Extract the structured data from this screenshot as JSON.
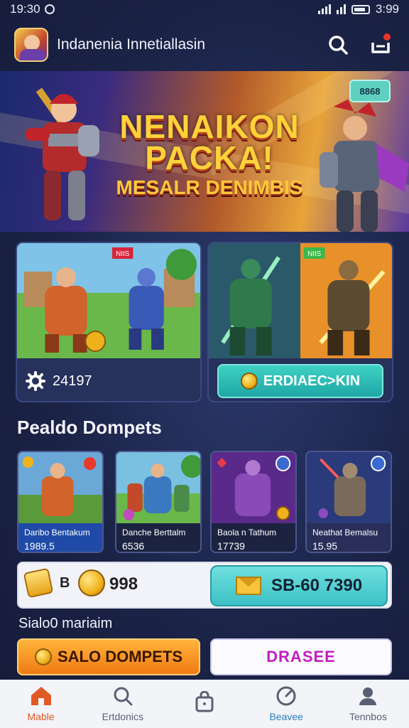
{
  "status_bar": {
    "time": "19:30",
    "clock_right": "3:99"
  },
  "header": {
    "title": "Indanenia Innetiallasin"
  },
  "hero": {
    "title_line1": "NENAIKON",
    "title_line2": "PACKA!",
    "title_line3": "MESALR DENIMBIS",
    "badge": "8868"
  },
  "promo_cards": [
    {
      "art_tag": "NIIS",
      "stat_value": "24197"
    },
    {
      "art_tag": "NIIS",
      "button_label": "ERDIAEC>KIN"
    }
  ],
  "section": {
    "title": "Pealdo Dompets"
  },
  "items": [
    {
      "name": "Daribo Bentakum",
      "price": "1989.5"
    },
    {
      "name": "Danche Berttalm",
      "price": "6536"
    },
    {
      "name": "Baola n Tathum",
      "price": "17739"
    },
    {
      "name": "Neathat Bemalsu",
      "price": "15.95"
    }
  ],
  "balance": {
    "coin_badge": "B",
    "value": "998",
    "button_label": "SB-60 7390"
  },
  "subtitle": "Sialo0 mariaim",
  "cta": {
    "left_label": "SALO DOMPETS",
    "right_label": "DRASEE"
  },
  "nav": [
    {
      "label": "Mable",
      "icon": "home-icon"
    },
    {
      "label": "Ertdonics",
      "icon": "search-icon"
    },
    {
      "label": "",
      "icon": "bag-icon"
    },
    {
      "label": "Beavee",
      "icon": "gauge-icon"
    },
    {
      "label": "Tennbos",
      "icon": "profile-icon"
    }
  ],
  "colors": {
    "accent_orange": "#f07a14",
    "accent_teal": "#3fd1c4",
    "accent_magenta": "#c21cc0",
    "bg_navy": "#1b2347"
  }
}
